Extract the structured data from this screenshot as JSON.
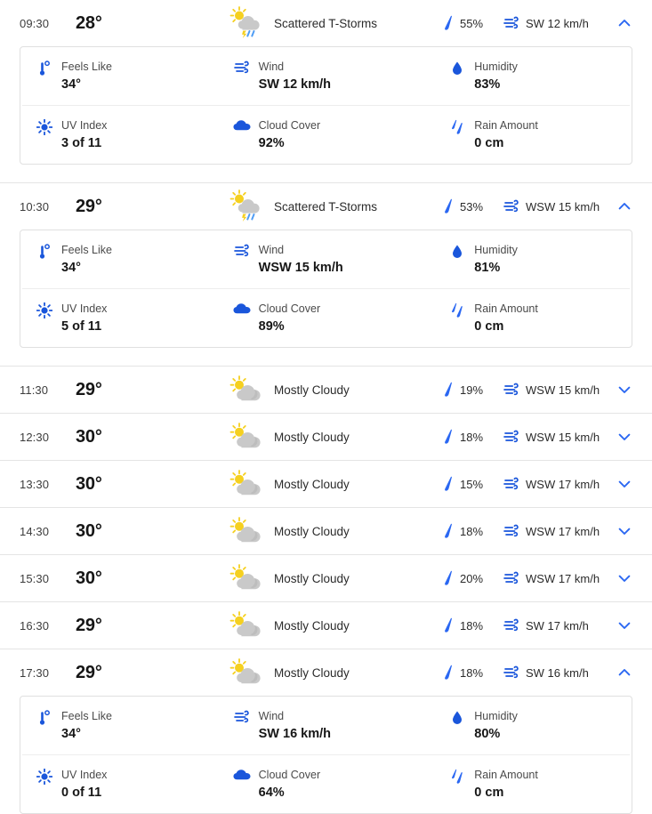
{
  "theme": {
    "accent_blue": "#2a67f2",
    "icon_blue": "#1a56db",
    "cloud_gray": "#c9c9c9",
    "sun_yellow": "#f5d020",
    "divider": "#e4e4e4",
    "card_border": "#e0e0e0"
  },
  "detail_labels": {
    "feels_like": "Feels Like",
    "wind": "Wind",
    "humidity": "Humidity",
    "uv_index": "UV Index",
    "cloud_cover": "Cloud Cover",
    "rain_amount": "Rain Amount"
  },
  "hours": [
    {
      "time": "09:30",
      "temp": "28°",
      "condition": "Scattered T-Storms",
      "condition_icon": "thunderstorm-icon",
      "precip": "55%",
      "wind": "SW 12 km/h",
      "expanded": true,
      "chevron": "chevron-up-icon",
      "details": {
        "feels_like": "34°",
        "wind": "SW 12 km/h",
        "humidity": "83%",
        "uv_index": "3 of 11",
        "cloud_cover": "92%",
        "rain_amount": "0 cm"
      }
    },
    {
      "time": "10:30",
      "temp": "29°",
      "condition": "Scattered T-Storms",
      "condition_icon": "thunderstorm-icon",
      "precip": "53%",
      "wind": "WSW 15 km/h",
      "expanded": true,
      "chevron": "chevron-up-icon",
      "details": {
        "feels_like": "34°",
        "wind": "WSW 15 km/h",
        "humidity": "81%",
        "uv_index": "5 of 11",
        "cloud_cover": "89%",
        "rain_amount": "0 cm"
      }
    },
    {
      "time": "11:30",
      "temp": "29°",
      "condition": "Mostly Cloudy",
      "condition_icon": "partly-cloudy-icon",
      "precip": "19%",
      "wind": "WSW 15 km/h",
      "expanded": false,
      "chevron": "chevron-down-icon"
    },
    {
      "time": "12:30",
      "temp": "30°",
      "condition": "Mostly Cloudy",
      "condition_icon": "partly-cloudy-icon",
      "precip": "18%",
      "wind": "WSW 15 km/h",
      "expanded": false,
      "chevron": "chevron-down-icon"
    },
    {
      "time": "13:30",
      "temp": "30°",
      "condition": "Mostly Cloudy",
      "condition_icon": "partly-cloudy-icon",
      "precip": "15%",
      "wind": "WSW 17 km/h",
      "expanded": false,
      "chevron": "chevron-down-icon"
    },
    {
      "time": "14:30",
      "temp": "30°",
      "condition": "Mostly Cloudy",
      "condition_icon": "partly-cloudy-icon",
      "precip": "18%",
      "wind": "WSW 17 km/h",
      "expanded": false,
      "chevron": "chevron-down-icon"
    },
    {
      "time": "15:30",
      "temp": "30°",
      "condition": "Mostly Cloudy",
      "condition_icon": "partly-cloudy-icon",
      "precip": "20%",
      "wind": "WSW 17 km/h",
      "expanded": false,
      "chevron": "chevron-down-icon"
    },
    {
      "time": "16:30",
      "temp": "29°",
      "condition": "Mostly Cloudy",
      "condition_icon": "partly-cloudy-icon",
      "precip": "18%",
      "wind": "SW 17 km/h",
      "expanded": false,
      "chevron": "chevron-down-icon"
    },
    {
      "time": "17:30",
      "temp": "29°",
      "condition": "Mostly Cloudy",
      "condition_icon": "partly-cloudy-icon",
      "precip": "18%",
      "wind": "SW 16 km/h",
      "expanded": true,
      "chevron": "chevron-up-icon",
      "details": {
        "feels_like": "34°",
        "wind": "SW 16 km/h",
        "humidity": "80%",
        "uv_index": "0 of 11",
        "cloud_cover": "64%",
        "rain_amount": "0 cm"
      }
    }
  ]
}
